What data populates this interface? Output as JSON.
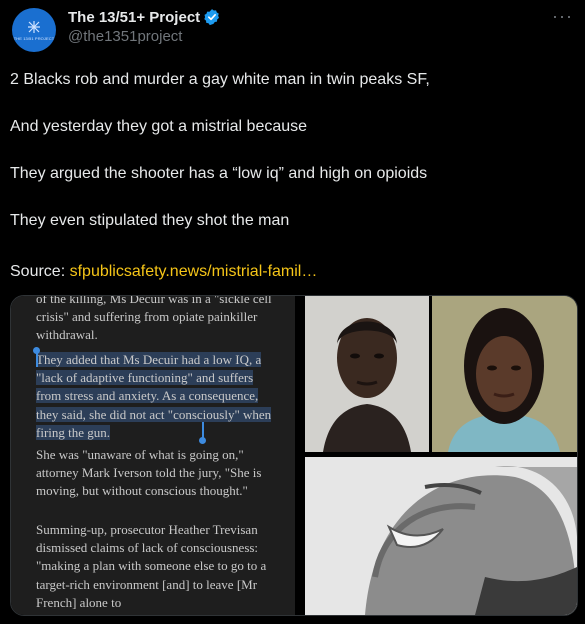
{
  "account": {
    "display_name": "The 13/51+ Project",
    "handle": "@the1351project",
    "avatar_text": "THE 13/51 PROJECT"
  },
  "menu": {
    "more_label": "···"
  },
  "tweet": {
    "lines": [
      "2 Blacks rob and murder a gay white man in twin peaks SF,",
      "And yesterday they got a mistrial because",
      "They argued the shooter has a “low iq” and high on opioids",
      "They even stipulated they shot the man"
    ],
    "source_label": "Source:",
    "source_link": "sfpublicsafety.news/mistrial-famil…"
  },
  "article": {
    "p1": "of the killing, Ms Decuir was in a \"sickle cell crisis\" and suffering from opiate painkiller withdrawal.",
    "p2": "They added that Ms Decuir had a low IQ, a \"lack of adaptive functioning\" and suffers from stress and anxiety. As a consequence, they said, she did not act \"consciously\" when firing the gun.",
    "p3": "She was \"unaware of what is going on,\" attorney Mark Iverson told the jury, \"She is moving, but without conscious thought.\"",
    "p4": "Summing-up, prosecutor Heather Trevisan dismissed claims of lack of consciousness: \"making a plan with someone else to go to a target-rich environment [and] to leave [Mr French] alone to"
  },
  "colors": {
    "background": "#000000",
    "text": "#e7e9ea",
    "muted": "#71767b",
    "link": "#f5c518",
    "verified": "#1d9bf0",
    "highlight": "#2c3e58"
  }
}
